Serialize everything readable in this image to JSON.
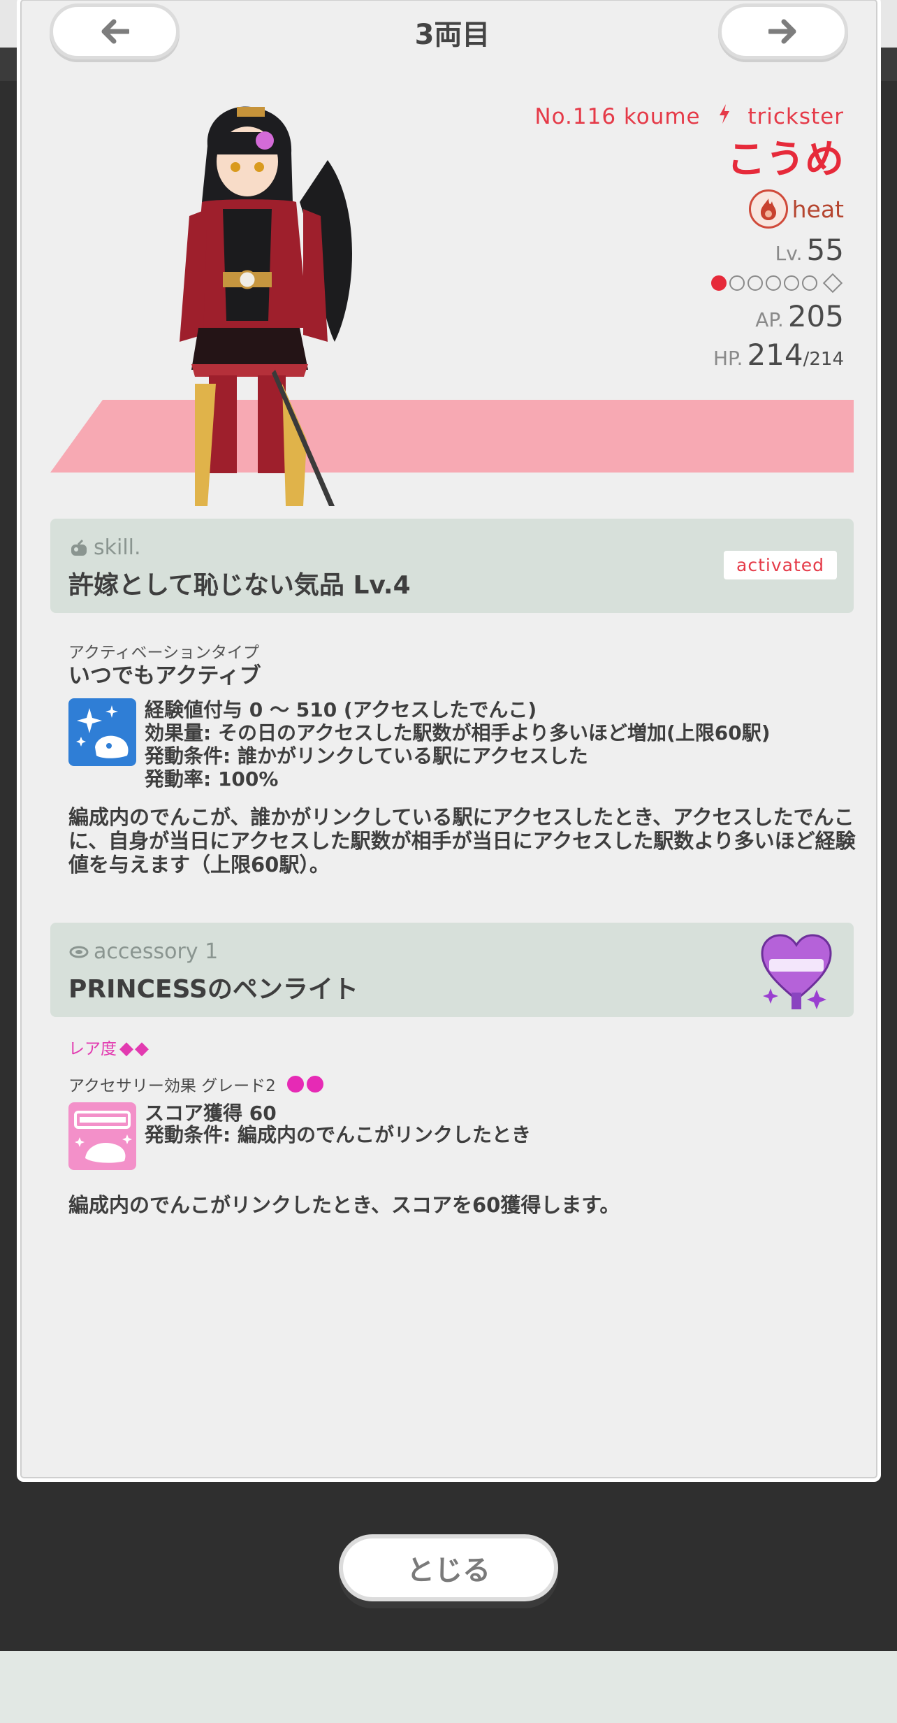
{
  "header": {
    "title": "3両目",
    "prev_icon": "arrow-left-icon",
    "next_icon": "arrow-right-icon"
  },
  "character": {
    "number": "No.116 koume",
    "type_icon": "lightning-icon",
    "type": "trickster",
    "name": "こうめ",
    "attribute_icon": "flame-icon",
    "attribute": "heat",
    "level_label": "Lv.",
    "level": "55",
    "rank_filled": 1,
    "rank_total": 6,
    "ap_label": "AP.",
    "ap": "205",
    "hp_label": "HP.",
    "hp_current": "214",
    "hp_max": "/214",
    "band_color": "#f7a9b3",
    "name_color": "#e62a3a"
  },
  "skill": {
    "kicker": "skill.",
    "title": "許嫁として恥じない気品 Lv.4",
    "status": "activated",
    "activation_type_label": "アクティベーションタイプ",
    "activation_type": "いつでもアクティブ",
    "icon": "sparkle-exp-icon",
    "effects": [
      "経験値付与 0 〜 510 (アクセスしたでんこ)",
      "効果量: その日のアクセスした駅数が相手より多いほど増加(上限60駅)",
      "発動条件: 誰かがリンクしている駅にアクセスした",
      "発動率: 100%"
    ],
    "description": "編成内のでんこが、誰かがリンクしている駅にアクセスしたとき、アクセスしたでんこに、自身が当日にアクセスした駅数が相手が当日にアクセスした駅数より多いほど経験値を与えます（上限60駅）。"
  },
  "accessory": {
    "kicker": "accessory 1",
    "title": "PRINCESSのペンライト",
    "art_icon": "princess-penlight-icon",
    "rarity_label": "レア度",
    "rarity_gems": "◆◆",
    "effect_label": "アクセサリー効果 グレード2",
    "grade_dots": 2,
    "icon": "score-card-icon",
    "effects": [
      "スコア獲得 60",
      "発動条件: 編成内のでんこがリンクしたとき"
    ],
    "description": "編成内のでんこがリンクしたとき、スコアを60獲得します。"
  },
  "footer": {
    "close_label": "とじる"
  }
}
